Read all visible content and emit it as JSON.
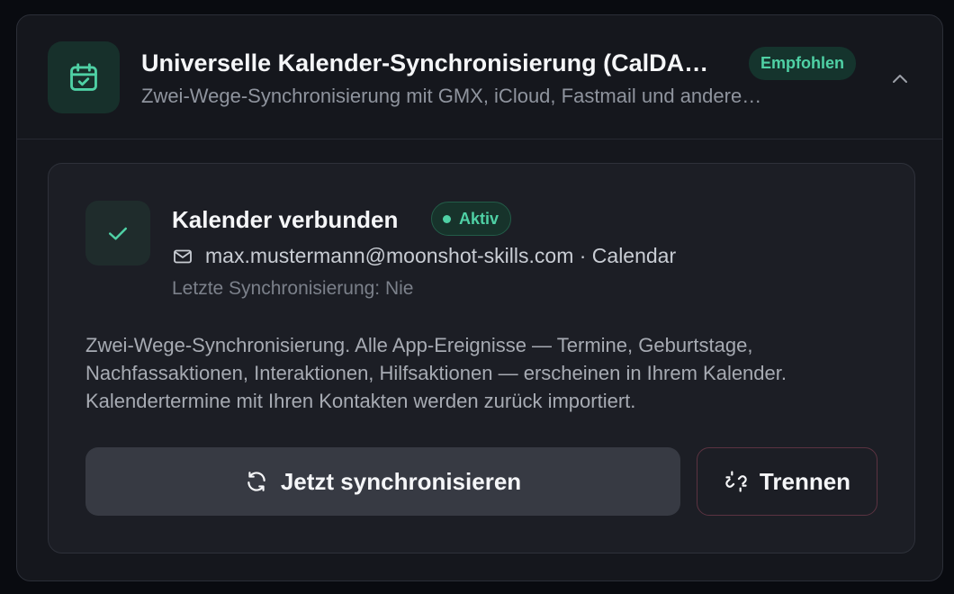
{
  "header": {
    "title": "Universelle Kalender-Synchronisierung (CalDA…",
    "badge": "Empfohlen",
    "subtitle": "Zwei-Wege-Synchronisierung mit GMX, iCloud, Fastmail und andere…"
  },
  "status": {
    "title": "Kalender verbunden",
    "badge": "Aktiv",
    "account": "max.mustermann@moonshot-skills.com · Calendar",
    "last_sync": "Letzte Synchronisierung: Nie"
  },
  "description": "Zwei-Wege-Synchronisierung. Alle App-Ereignisse — Termine, Geburtstage, Nachfassaktionen, Interaktionen, Hilfsaktionen — erscheinen in Ihrem Kalender. Kalendertermine mit Ihren Kontakten werden zurück importiert.",
  "actions": {
    "sync_label": "Jetzt synchronisieren",
    "disconnect_label": "Trennen"
  },
  "icons": {
    "header": "calendar-check-icon",
    "collapse": "chevron-up-icon",
    "status": "check-icon",
    "account": "mail-icon",
    "sync": "refresh-icon",
    "disconnect": "unlink-icon"
  },
  "colors": {
    "accent": "#4fd1a5",
    "background": "#15171d",
    "button": "#373a43",
    "danger_border": "#5b3341"
  }
}
